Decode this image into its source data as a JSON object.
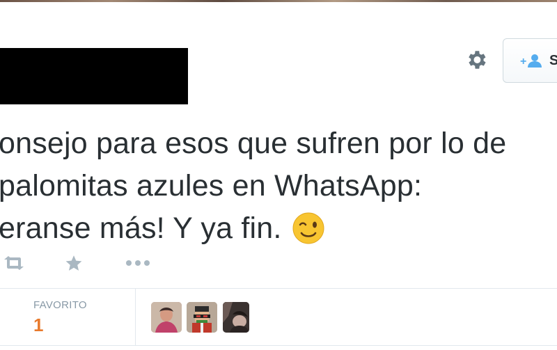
{
  "header": {
    "follow_label": "S",
    "follow_icon": "follow-person-plus-icon",
    "settings_icon": "gear-icon"
  },
  "tweet": {
    "lines": [
      "onsejo para esos que sufren por lo de",
      "palomitas azules en WhatsApp:",
      "eranse más! Y ya fin."
    ],
    "emoji": "winking-face-emoji"
  },
  "actions": {
    "retweet_icon": "retweet-icon",
    "favorite_icon": "star-icon",
    "more_icon": "more-dots-icon"
  },
  "stats": {
    "favorites_label": "FAVORITO",
    "favorites_count": "1"
  },
  "colors": {
    "text": "#292f33",
    "muted": "#8899a6",
    "accent_orange": "#e87a2c",
    "icon_gray": "#aab8c2",
    "follow_blue": "#55acee",
    "border": "#e1e8ed"
  }
}
